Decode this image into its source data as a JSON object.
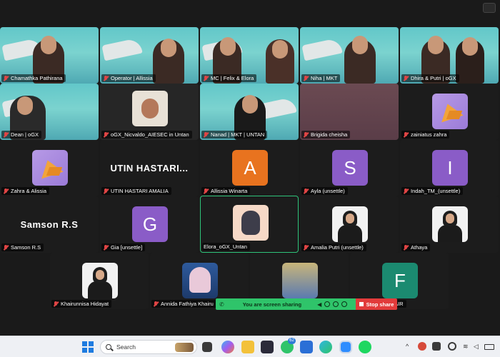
{
  "participants": {
    "row1": [
      {
        "name": "Chamathka Pathirana"
      },
      {
        "name": "Operator | Allissia"
      },
      {
        "name": "MC | Felix & Elora"
      },
      {
        "name": "Niha | MKT"
      },
      {
        "name": "Dhira & Putri | oGX"
      }
    ],
    "row2": [
      {
        "name": "Dean | oGX"
      },
      {
        "name": "oGX_Nicvaldo_AIESEC in Untan"
      },
      {
        "name": "Nanad | MKT | UNTAN"
      },
      {
        "name": "Brigida cheisha"
      },
      {
        "name": "zainiatus zahra"
      }
    ],
    "row3": [
      {
        "name": "Zahra & Alissia"
      },
      {
        "name": "UTIN HASTARI AMALIA",
        "display": "UTIN  HASTARI..."
      },
      {
        "name": "Allissia Winarta",
        "initial": "A",
        "color": "#e8731f"
      },
      {
        "name": "Ayla (unsettle)",
        "initial": "S",
        "color": "#8a5cc7"
      },
      {
        "name": "Indah_TM_(unsettle)",
        "initial": "I",
        "color": "#8a5cc7"
      }
    ],
    "row4": [
      {
        "name": "Samson R.S",
        "display": "Samson R.S"
      },
      {
        "name": "Gia [unsettle]",
        "initial": "G",
        "color": "#8a5cc7"
      },
      {
        "name": "Elora_oGX_Untan"
      },
      {
        "name": "Amalia Putri (unsettle)"
      },
      {
        "name": "Athaya"
      }
    ],
    "row5": [
      {
        "name": "Khairunnisa Hidayat"
      },
      {
        "name": "Annida Fathiya Khairu"
      },
      {
        "name": ""
      },
      {
        "name": "AIR",
        "initial": "F",
        "color": "#1b8a70"
      }
    ]
  },
  "share": {
    "text": "You are screen sharing",
    "stop_label": "Stop share"
  },
  "taskbar": {
    "search_placeholder": "Search",
    "chat_badge": "62"
  }
}
